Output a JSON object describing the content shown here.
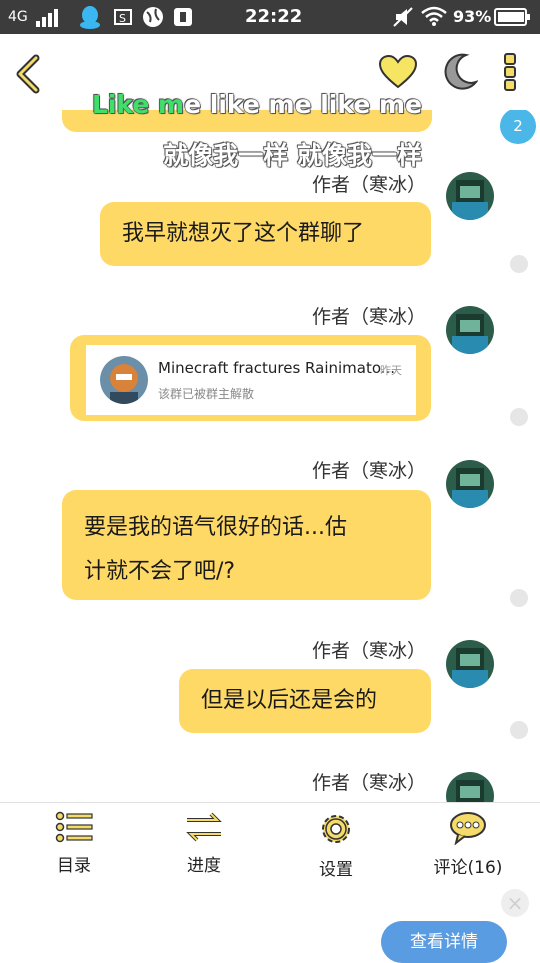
{
  "status_bar": {
    "network": "4G",
    "time": "22:22",
    "battery": "93%"
  },
  "toolbar": {
    "back": "back",
    "like": "heart-icon",
    "night_mode": "moon-icon",
    "more": "more-icon"
  },
  "subtitle": {
    "line1_highlight": "Like m",
    "line1_rest": "e like me like me",
    "line2": "就像我一样 就像我一样"
  },
  "chat": {
    "unread_badge": "2",
    "messages": [
      {
        "author": "作者（寒冰）",
        "text": "我早就想灭了这个群聊了"
      },
      {
        "author": "作者（寒冰）",
        "card": {
          "title": "Minecraft fractures Rainimato...",
          "time": "昨天",
          "subtitle": "该群已被群主解散"
        }
      },
      {
        "author": "作者（寒冰）",
        "text_line1": "要是我的语气很好的话...估",
        "text_line2": "计就不会了吧/?"
      },
      {
        "author": "作者（寒冰）",
        "text": "但是以后还是会的"
      },
      {
        "author": "作者（寒冰）"
      }
    ]
  },
  "bottom_nav": {
    "items": [
      {
        "label": "目录"
      },
      {
        "label": "进度"
      },
      {
        "label": "设置"
      },
      {
        "label": "评论(16)"
      }
    ],
    "detail_button": "查看详情",
    "close": "×"
  },
  "colors": {
    "bubble": "#ffd966",
    "accent_blue": "#5a9ce2",
    "badge_blue": "#4bb6e8",
    "icon_yellow": "#f5dc6a"
  }
}
